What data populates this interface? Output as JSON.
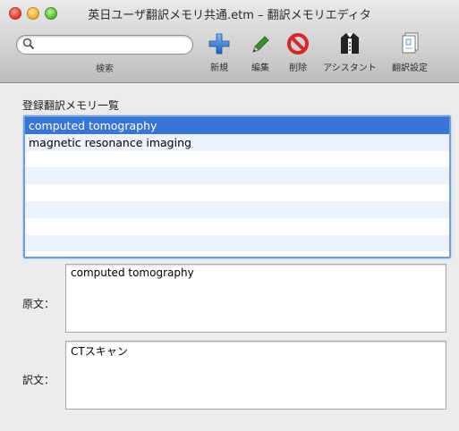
{
  "window": {
    "title": "英日ユーザ翻訳メモリ共通.etm – 翻訳メモリエディタ"
  },
  "toolbar": {
    "search_label": "検索",
    "search_value": "",
    "new_label": "新規",
    "edit_label": "編集",
    "delete_label": "削除",
    "assistant_label": "アシスタント",
    "settings_label": "翻訳設定"
  },
  "icons": {
    "new": "plus-icon",
    "edit": "pencil-icon",
    "delete": "prohibit-icon",
    "assistant": "tuxedo-icon",
    "settings": "document-icon",
    "search": "magnifier-icon"
  },
  "colors": {
    "selection": "#3875d7",
    "alt_row": "#edf3fe",
    "focus_ring": "#6f9fd8"
  },
  "memory_list": {
    "label": "登録翻訳メモリ一覧",
    "items": [
      "computed tomography",
      "magnetic resonance imaging"
    ],
    "selected_index": 0
  },
  "source": {
    "label": "原文：",
    "value": "computed tomography"
  },
  "target": {
    "label": "訳文：",
    "value": "CTスキャン"
  }
}
